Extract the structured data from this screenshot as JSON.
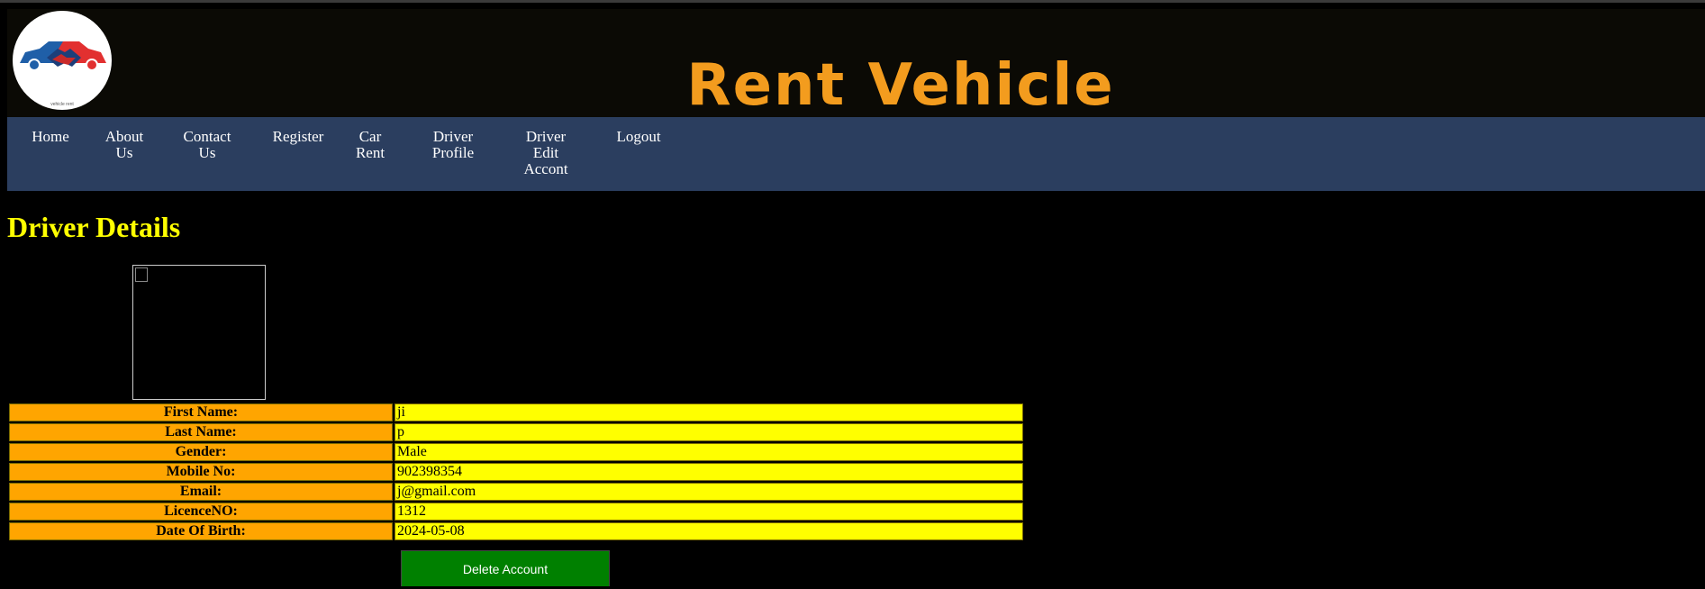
{
  "header": {
    "logo_icon": "rent-vehicle-logo",
    "logo_caption": "vehicle rent",
    "title": "Rent Vehicle"
  },
  "nav": {
    "items": [
      {
        "label": "Home"
      },
      {
        "label": "About Us"
      },
      {
        "label": "Contact Us"
      },
      {
        "label": "Register"
      },
      {
        "label": "Car Rent"
      },
      {
        "label": "Driver Profile"
      },
      {
        "label": "Driver Edit Accont"
      },
      {
        "label": "Logout"
      }
    ]
  },
  "main": {
    "heading": "Driver Details",
    "photo_icon": "broken-image-icon",
    "details": [
      {
        "label": "First Name:",
        "value": "ji"
      },
      {
        "label": "Last Name:",
        "value": "p"
      },
      {
        "label": "Gender:",
        "value": "Male"
      },
      {
        "label": "Mobile No:",
        "value": "902398354"
      },
      {
        "label": "Email:",
        "value": "j@gmail.com"
      },
      {
        "label": "LicenceNO:",
        "value": "1312"
      },
      {
        "label": "Date Of Birth:",
        "value": "2024-05-08"
      }
    ],
    "delete_label": "Delete Account"
  },
  "colors": {
    "title": "#f39c1e",
    "nav_bg": "#2b3e5f",
    "heading": "#ffff00",
    "label_bg": "#ffa500",
    "value_bg": "#ffff00",
    "button_bg": "#008000"
  }
}
